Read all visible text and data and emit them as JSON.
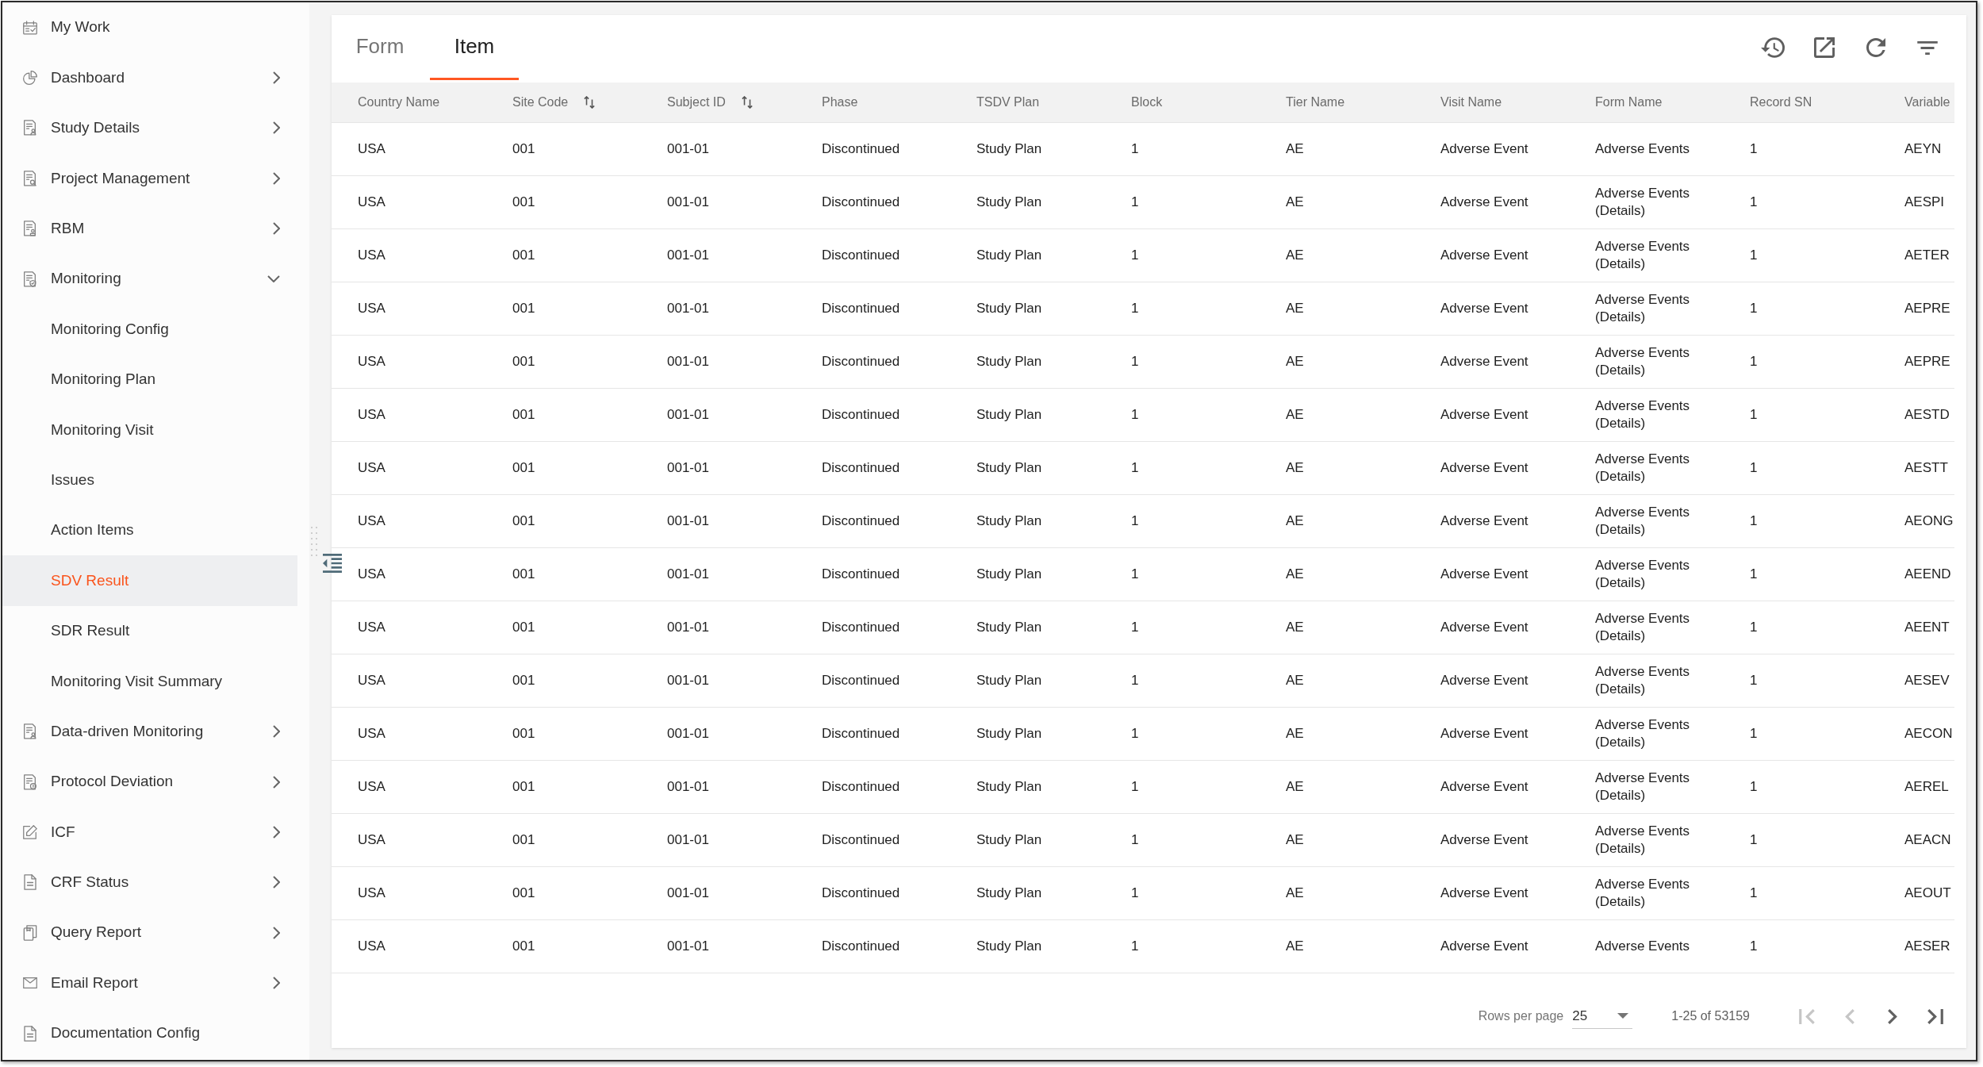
{
  "sidebar": {
    "items": [
      {
        "kind": "link",
        "label": "My Work",
        "selected": false
      },
      {
        "kind": "group",
        "label": "Dashboard",
        "expanded": false,
        "selected": false
      },
      {
        "kind": "group",
        "label": "Study Details",
        "expanded": false,
        "selected": false
      },
      {
        "kind": "group",
        "label": "Project Management",
        "expanded": false,
        "selected": false
      },
      {
        "kind": "group",
        "label": "RBM",
        "expanded": false,
        "selected": false
      },
      {
        "kind": "group",
        "label": "Monitoring",
        "expanded": true,
        "selected": false,
        "children": [
          {
            "label": "Monitoring Config",
            "selected": false
          },
          {
            "label": "Monitoring Plan",
            "selected": false
          },
          {
            "label": "Monitoring Visit",
            "selected": false
          },
          {
            "label": "Issues",
            "selected": false
          },
          {
            "label": "Action Items",
            "selected": false
          },
          {
            "label": "SDV Result",
            "selected": true
          },
          {
            "label": "SDR Result",
            "selected": false
          },
          {
            "label": "Monitoring Visit Summary",
            "selected": false
          }
        ]
      },
      {
        "kind": "group",
        "label": "Data-driven Monitoring",
        "expanded": false,
        "selected": false
      },
      {
        "kind": "group",
        "label": "Protocol Deviation",
        "expanded": false,
        "selected": false
      },
      {
        "kind": "group",
        "label": "ICF",
        "expanded": false,
        "selected": false
      },
      {
        "kind": "group",
        "label": "CRF Status",
        "expanded": false,
        "selected": false
      },
      {
        "kind": "group",
        "label": "Query Report",
        "expanded": false,
        "selected": false
      },
      {
        "kind": "group",
        "label": "Email Report",
        "expanded": false,
        "selected": false
      },
      {
        "kind": "link",
        "label": "Documentation Config",
        "selected": false
      }
    ]
  },
  "tabs": [
    {
      "label": "Form",
      "selected": false
    },
    {
      "label": "Item",
      "selected": true
    }
  ],
  "table": {
    "columns": [
      {
        "label": "Country Name",
        "sortable": false
      },
      {
        "label": "Site Code",
        "sortable": true
      },
      {
        "label": "Subject ID",
        "sortable": true
      },
      {
        "label": "Phase",
        "sortable": false
      },
      {
        "label": "TSDV Plan",
        "sortable": false
      },
      {
        "label": "Block",
        "sortable": false
      },
      {
        "label": "Tier Name",
        "sortable": false
      },
      {
        "label": "Visit Name",
        "sortable": false
      },
      {
        "label": "Form Name",
        "sortable": false
      },
      {
        "label": "Record SN",
        "sortable": false
      },
      {
        "label": "Variable",
        "sortable": false
      }
    ],
    "rows": [
      [
        "USA",
        "001",
        "001-01",
        "Discontinued",
        "Study Plan",
        "1",
        "AE",
        "Adverse Event",
        "Adverse Events",
        "1",
        "AEYN"
      ],
      [
        "USA",
        "001",
        "001-01",
        "Discontinued",
        "Study Plan",
        "1",
        "AE",
        "Adverse Event",
        "Adverse Events (Details)",
        "1",
        "AESPI"
      ],
      [
        "USA",
        "001",
        "001-01",
        "Discontinued",
        "Study Plan",
        "1",
        "AE",
        "Adverse Event",
        "Adverse Events (Details)",
        "1",
        "AETER"
      ],
      [
        "USA",
        "001",
        "001-01",
        "Discontinued",
        "Study Plan",
        "1",
        "AE",
        "Adverse Event",
        "Adverse Events (Details)",
        "1",
        "AEPRE"
      ],
      [
        "USA",
        "001",
        "001-01",
        "Discontinued",
        "Study Plan",
        "1",
        "AE",
        "Adverse Event",
        "Adverse Events (Details)",
        "1",
        "AEPRE"
      ],
      [
        "USA",
        "001",
        "001-01",
        "Discontinued",
        "Study Plan",
        "1",
        "AE",
        "Adverse Event",
        "Adverse Events (Details)",
        "1",
        "AESTD"
      ],
      [
        "USA",
        "001",
        "001-01",
        "Discontinued",
        "Study Plan",
        "1",
        "AE",
        "Adverse Event",
        "Adverse Events (Details)",
        "1",
        "AESTT"
      ],
      [
        "USA",
        "001",
        "001-01",
        "Discontinued",
        "Study Plan",
        "1",
        "AE",
        "Adverse Event",
        "Adverse Events (Details)",
        "1",
        "AEONG"
      ],
      [
        "USA",
        "001",
        "001-01",
        "Discontinued",
        "Study Plan",
        "1",
        "AE",
        "Adverse Event",
        "Adverse Events (Details)",
        "1",
        "AEEND"
      ],
      [
        "USA",
        "001",
        "001-01",
        "Discontinued",
        "Study Plan",
        "1",
        "AE",
        "Adverse Event",
        "Adverse Events (Details)",
        "1",
        "AEENT"
      ],
      [
        "USA",
        "001",
        "001-01",
        "Discontinued",
        "Study Plan",
        "1",
        "AE",
        "Adverse Event",
        "Adverse Events (Details)",
        "1",
        "AESEV"
      ],
      [
        "USA",
        "001",
        "001-01",
        "Discontinued",
        "Study Plan",
        "1",
        "AE",
        "Adverse Event",
        "Adverse Events (Details)",
        "1",
        "AECON"
      ],
      [
        "USA",
        "001",
        "001-01",
        "Discontinued",
        "Study Plan",
        "1",
        "AE",
        "Adverse Event",
        "Adverse Events (Details)",
        "1",
        "AEREL"
      ],
      [
        "USA",
        "001",
        "001-01",
        "Discontinued",
        "Study Plan",
        "1",
        "AE",
        "Adverse Event",
        "Adverse Events (Details)",
        "1",
        "AEACN"
      ],
      [
        "USA",
        "001",
        "001-01",
        "Discontinued",
        "Study Plan",
        "1",
        "AE",
        "Adverse Event",
        "Adverse Events (Details)",
        "1",
        "AEOUT"
      ],
      [
        "USA",
        "001",
        "001-01",
        "Discontinued",
        "Study Plan",
        "1",
        "AE",
        "Adverse Event",
        "Adverse Events",
        "1",
        "AESER"
      ]
    ]
  },
  "pagination": {
    "rows_per_page_label": "Rows per page",
    "rows_per_page": "25",
    "range": "1-25 of 53159",
    "buttons": [
      {
        "disabled": true
      },
      {
        "disabled": true
      },
      {
        "disabled": false
      },
      {
        "disabled": false
      }
    ]
  }
}
